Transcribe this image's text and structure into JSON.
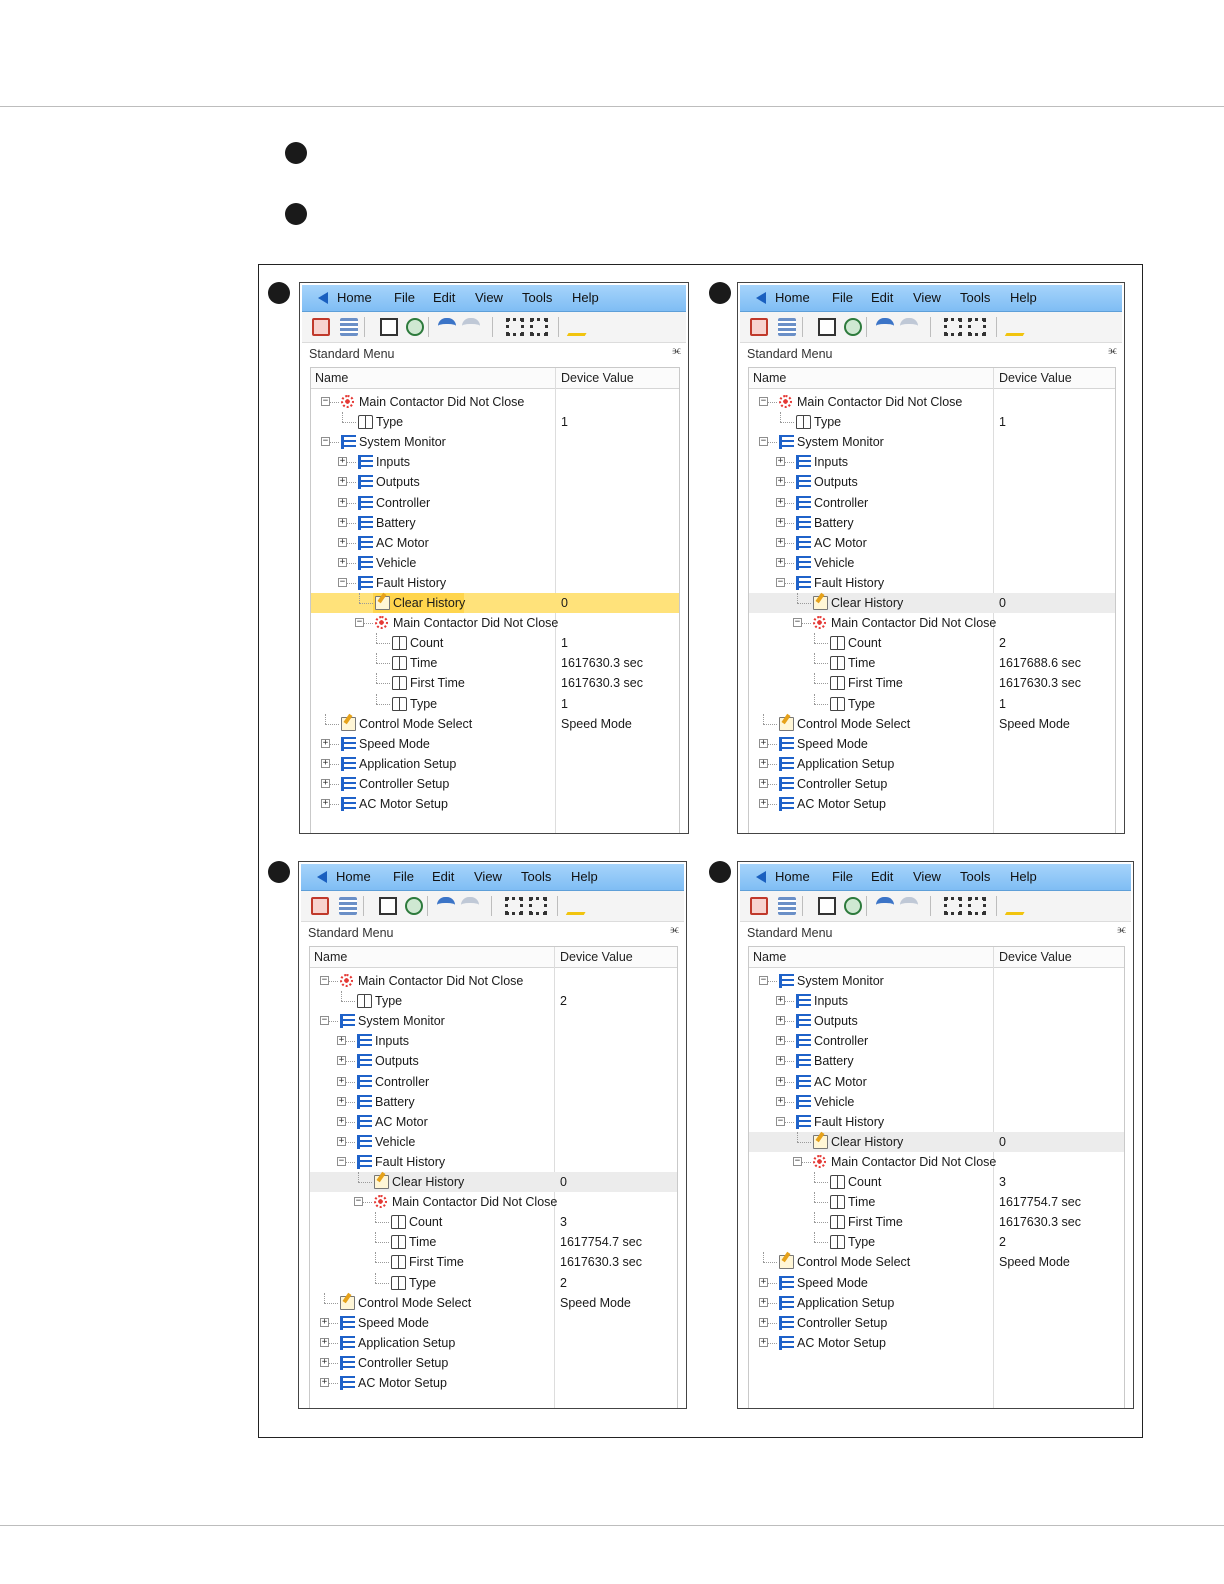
{
  "menu": [
    "Home",
    "File",
    "Edit",
    "View",
    "Tools",
    "Help"
  ],
  "panel_title": "Standard Menu",
  "pin_glyph": "ⱗ",
  "columns": [
    "Name",
    "Device Value"
  ],
  "icons": {
    "list": "list-icon",
    "fault": "fault-icon",
    "book": "book-icon",
    "edit": "edit-icon",
    "toolbar": [
      "program-icon",
      "list-toggle-icon",
      "parameter-icon",
      "monitor-icon",
      "undo-icon",
      "redo-icon",
      "expand-icon",
      "collapse-icon",
      "edit-icon"
    ]
  },
  "colors": {
    "menubar": "#8ec8f8",
    "selected_row": "#ececec",
    "highlight_row": "#ffe27a",
    "fault_icon": "#e53935",
    "list_icon": "#1f62c9"
  },
  "screens": [
    {
      "rows": [
        {
          "d": 0,
          "exp": "-",
          "icon": "fault",
          "label": "Main Contactor Did Not Close",
          "value": ""
        },
        {
          "d": 1,
          "exp": "",
          "icon": "book",
          "label": "Type",
          "value": "1"
        },
        {
          "d": 0,
          "exp": "-",
          "icon": "list",
          "label": "System Monitor",
          "value": ""
        },
        {
          "d": 1,
          "exp": "+",
          "icon": "list",
          "label": "Inputs",
          "value": ""
        },
        {
          "d": 1,
          "exp": "+",
          "icon": "list",
          "label": "Outputs",
          "value": ""
        },
        {
          "d": 1,
          "exp": "+",
          "icon": "list",
          "label": "Controller",
          "value": ""
        },
        {
          "d": 1,
          "exp": "+",
          "icon": "list",
          "label": "Battery",
          "value": ""
        },
        {
          "d": 1,
          "exp": "+",
          "icon": "list",
          "label": "AC Motor",
          "value": ""
        },
        {
          "d": 1,
          "exp": "+",
          "icon": "list",
          "label": "Vehicle",
          "value": ""
        },
        {
          "d": 1,
          "exp": "-",
          "icon": "list",
          "label": "Fault History",
          "value": ""
        },
        {
          "d": 2,
          "exp": "",
          "icon": "edit",
          "label": "Clear History",
          "value": "0",
          "state": "highlight"
        },
        {
          "d": 2,
          "exp": "-",
          "icon": "fault",
          "label": "Main Contactor Did Not Close",
          "value": ""
        },
        {
          "d": 3,
          "exp": "",
          "icon": "book",
          "label": "Count",
          "value": "1"
        },
        {
          "d": 3,
          "exp": "",
          "icon": "book",
          "label": "Time",
          "value": "1617630.3 sec"
        },
        {
          "d": 3,
          "exp": "",
          "icon": "book",
          "label": "First Time",
          "value": "1617630.3 sec"
        },
        {
          "d": 3,
          "exp": "",
          "icon": "book",
          "label": "Type",
          "value": "1"
        },
        {
          "d": 0,
          "exp": "",
          "icon": "edit",
          "label": "Control Mode Select",
          "value": "Speed Mode"
        },
        {
          "d": 0,
          "exp": "+",
          "icon": "list",
          "label": "Speed Mode",
          "value": ""
        },
        {
          "d": 0,
          "exp": "+",
          "icon": "list",
          "label": "Application Setup",
          "value": ""
        },
        {
          "d": 0,
          "exp": "+",
          "icon": "list",
          "label": "Controller Setup",
          "value": ""
        },
        {
          "d": 0,
          "exp": "+",
          "icon": "list",
          "label": "AC Motor Setup",
          "value": ""
        }
      ]
    },
    {
      "rows": [
        {
          "d": 0,
          "exp": "-",
          "icon": "fault",
          "label": "Main Contactor Did Not Close",
          "value": ""
        },
        {
          "d": 1,
          "exp": "",
          "icon": "book",
          "label": "Type",
          "value": "1"
        },
        {
          "d": 0,
          "exp": "-",
          "icon": "list",
          "label": "System Monitor",
          "value": ""
        },
        {
          "d": 1,
          "exp": "+",
          "icon": "list",
          "label": "Inputs",
          "value": ""
        },
        {
          "d": 1,
          "exp": "+",
          "icon": "list",
          "label": "Outputs",
          "value": ""
        },
        {
          "d": 1,
          "exp": "+",
          "icon": "list",
          "label": "Controller",
          "value": ""
        },
        {
          "d": 1,
          "exp": "+",
          "icon": "list",
          "label": "Battery",
          "value": ""
        },
        {
          "d": 1,
          "exp": "+",
          "icon": "list",
          "label": "AC Motor",
          "value": ""
        },
        {
          "d": 1,
          "exp": "+",
          "icon": "list",
          "label": "Vehicle",
          "value": ""
        },
        {
          "d": 1,
          "exp": "-",
          "icon": "list",
          "label": "Fault History",
          "value": ""
        },
        {
          "d": 2,
          "exp": "",
          "icon": "edit",
          "label": "Clear History",
          "value": "0",
          "state": "selected"
        },
        {
          "d": 2,
          "exp": "-",
          "icon": "fault",
          "label": "Main Contactor Did Not Close",
          "value": ""
        },
        {
          "d": 3,
          "exp": "",
          "icon": "book",
          "label": "Count",
          "value": "2"
        },
        {
          "d": 3,
          "exp": "",
          "icon": "book",
          "label": "Time",
          "value": "1617688.6 sec"
        },
        {
          "d": 3,
          "exp": "",
          "icon": "book",
          "label": "First Time",
          "value": "1617630.3 sec"
        },
        {
          "d": 3,
          "exp": "",
          "icon": "book",
          "label": "Type",
          "value": "1"
        },
        {
          "d": 0,
          "exp": "",
          "icon": "edit",
          "label": "Control Mode Select",
          "value": "Speed Mode"
        },
        {
          "d": 0,
          "exp": "+",
          "icon": "list",
          "label": "Speed Mode",
          "value": ""
        },
        {
          "d": 0,
          "exp": "+",
          "icon": "list",
          "label": "Application Setup",
          "value": ""
        },
        {
          "d": 0,
          "exp": "+",
          "icon": "list",
          "label": "Controller Setup",
          "value": ""
        },
        {
          "d": 0,
          "exp": "+",
          "icon": "list",
          "label": "AC Motor Setup",
          "value": ""
        }
      ]
    },
    {
      "rows": [
        {
          "d": 0,
          "exp": "-",
          "icon": "fault",
          "label": "Main Contactor Did Not Close",
          "value": ""
        },
        {
          "d": 1,
          "exp": "",
          "icon": "book",
          "label": "Type",
          "value": "2"
        },
        {
          "d": 0,
          "exp": "-",
          "icon": "list",
          "label": "System Monitor",
          "value": ""
        },
        {
          "d": 1,
          "exp": "+",
          "icon": "list",
          "label": "Inputs",
          "value": ""
        },
        {
          "d": 1,
          "exp": "+",
          "icon": "list",
          "label": "Outputs",
          "value": ""
        },
        {
          "d": 1,
          "exp": "+",
          "icon": "list",
          "label": "Controller",
          "value": ""
        },
        {
          "d": 1,
          "exp": "+",
          "icon": "list",
          "label": "Battery",
          "value": ""
        },
        {
          "d": 1,
          "exp": "+",
          "icon": "list",
          "label": "AC Motor",
          "value": ""
        },
        {
          "d": 1,
          "exp": "+",
          "icon": "list",
          "label": "Vehicle",
          "value": ""
        },
        {
          "d": 1,
          "exp": "-",
          "icon": "list",
          "label": "Fault History",
          "value": ""
        },
        {
          "d": 2,
          "exp": "",
          "icon": "edit",
          "label": "Clear History",
          "value": "0",
          "state": "selected"
        },
        {
          "d": 2,
          "exp": "-",
          "icon": "fault",
          "label": "Main Contactor Did Not Close",
          "value": ""
        },
        {
          "d": 3,
          "exp": "",
          "icon": "book",
          "label": "Count",
          "value": "3"
        },
        {
          "d": 3,
          "exp": "",
          "icon": "book",
          "label": "Time",
          "value": "1617754.7 sec"
        },
        {
          "d": 3,
          "exp": "",
          "icon": "book",
          "label": "First Time",
          "value": "1617630.3 sec"
        },
        {
          "d": 3,
          "exp": "",
          "icon": "book",
          "label": "Type",
          "value": "2"
        },
        {
          "d": 0,
          "exp": "",
          "icon": "edit",
          "label": "Control Mode Select",
          "value": "Speed Mode"
        },
        {
          "d": 0,
          "exp": "+",
          "icon": "list",
          "label": "Speed Mode",
          "value": ""
        },
        {
          "d": 0,
          "exp": "+",
          "icon": "list",
          "label": "Application Setup",
          "value": ""
        },
        {
          "d": 0,
          "exp": "+",
          "icon": "list",
          "label": "Controller Setup",
          "value": ""
        },
        {
          "d": 0,
          "exp": "+",
          "icon": "list",
          "label": "AC Motor Setup",
          "value": ""
        }
      ]
    },
    {
      "rows": [
        {
          "d": 0,
          "exp": "-",
          "icon": "list",
          "label": "System Monitor",
          "value": ""
        },
        {
          "d": 1,
          "exp": "+",
          "icon": "list",
          "label": "Inputs",
          "value": ""
        },
        {
          "d": 1,
          "exp": "+",
          "icon": "list",
          "label": "Outputs",
          "value": ""
        },
        {
          "d": 1,
          "exp": "+",
          "icon": "list",
          "label": "Controller",
          "value": ""
        },
        {
          "d": 1,
          "exp": "+",
          "icon": "list",
          "label": "Battery",
          "value": ""
        },
        {
          "d": 1,
          "exp": "+",
          "icon": "list",
          "label": "AC Motor",
          "value": ""
        },
        {
          "d": 1,
          "exp": "+",
          "icon": "list",
          "label": "Vehicle",
          "value": ""
        },
        {
          "d": 1,
          "exp": "-",
          "icon": "list",
          "label": "Fault History",
          "value": ""
        },
        {
          "d": 2,
          "exp": "",
          "icon": "edit",
          "label": "Clear History",
          "value": "0",
          "state": "selected"
        },
        {
          "d": 2,
          "exp": "-",
          "icon": "fault",
          "label": "Main Contactor Did Not Close",
          "value": ""
        },
        {
          "d": 3,
          "exp": "",
          "icon": "book",
          "label": "Count",
          "value": "3"
        },
        {
          "d": 3,
          "exp": "",
          "icon": "book",
          "label": "Time",
          "value": "1617754.7 sec"
        },
        {
          "d": 3,
          "exp": "",
          "icon": "book",
          "label": "First Time",
          "value": "1617630.3 sec"
        },
        {
          "d": 3,
          "exp": "",
          "icon": "book",
          "label": "Type",
          "value": "2"
        },
        {
          "d": 0,
          "exp": "",
          "icon": "edit",
          "label": "Control Mode Select",
          "value": "Speed Mode"
        },
        {
          "d": 0,
          "exp": "+",
          "icon": "list",
          "label": "Speed Mode",
          "value": ""
        },
        {
          "d": 0,
          "exp": "+",
          "icon": "list",
          "label": "Application Setup",
          "value": ""
        },
        {
          "d": 0,
          "exp": "+",
          "icon": "list",
          "label": "Controller Setup",
          "value": ""
        },
        {
          "d": 0,
          "exp": "+",
          "icon": "list",
          "label": "AC Motor Setup",
          "value": ""
        }
      ]
    }
  ]
}
